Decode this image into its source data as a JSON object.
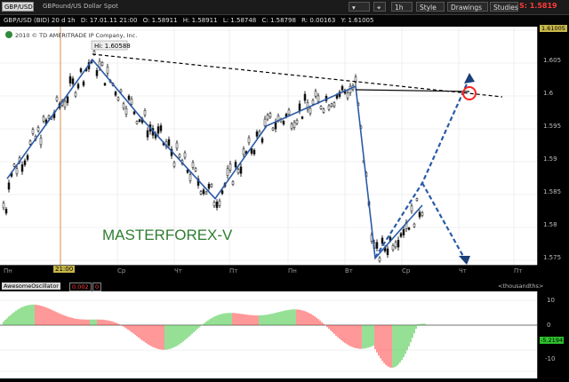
{
  "toolbar": {
    "symbol": "GBP/USD",
    "description": "GBPound/US Dollar Spot",
    "period": "1h",
    "style_label": "Style",
    "drawings_label": "Drawings",
    "studies_label": "Studies",
    "last_price": "S: 1.5819"
  },
  "info_bar": {
    "title": "GBP/USD (BID) 20 d 1h",
    "date": "D: 17.01.11 21:00",
    "open": "O: 1.58911",
    "high": "H: 1.58911",
    "low": "L: 1.58748",
    "close": "C: 1.58798",
    "range": "R: 0.00163",
    "y": "Y: 1.61005"
  },
  "copyright": "2010 © TD AMERITRADE IP Company, Inc.",
  "hi_label": "Hi: 1.60588",
  "watermark": "MASTERFOREX-V",
  "price_axis": {
    "top_label": "1.61005",
    "ticks": [
      "1.605",
      "1.6",
      "1.595",
      "1.59",
      "1.585",
      "1.58",
      "1.575"
    ]
  },
  "time_axis": {
    "highlight": "21:00",
    "labels": [
      "Пн",
      "Ср",
      "Чт",
      "Пт",
      "Пн",
      "Вт",
      "Ср",
      "Чт",
      "Пт"
    ]
  },
  "oscillator": {
    "name": "AwesomeOscillator",
    "value": "0.002",
    "extra": "0",
    "units": "<thousandths>",
    "ticks": [
      "10",
      "0",
      "-5.2194",
      "-10"
    ],
    "current": "-5.21.94"
  },
  "colors": {
    "up_bar": "#2ec02e",
    "down_bar": "#ff3030",
    "pattern_line": "#2a5aa8",
    "trend_line": "#000000",
    "target_circle": "#ff2020",
    "price_box": "#ff3b3b"
  },
  "chart_data": {
    "type": "line",
    "title": "",
    "x": [
      "Пн",
      "Ср",
      "Чт",
      "Пт",
      "Пн",
      "Вт",
      "Ср",
      "Чт",
      "Пт"
    ],
    "ylim": [
      1.574,
      1.61
    ],
    "series": [
      {
        "values": [
          1.587,
          1.605,
          1.596,
          1.584,
          1.595,
          1.601,
          1.575,
          1.583
        ]
      }
    ]
  }
}
